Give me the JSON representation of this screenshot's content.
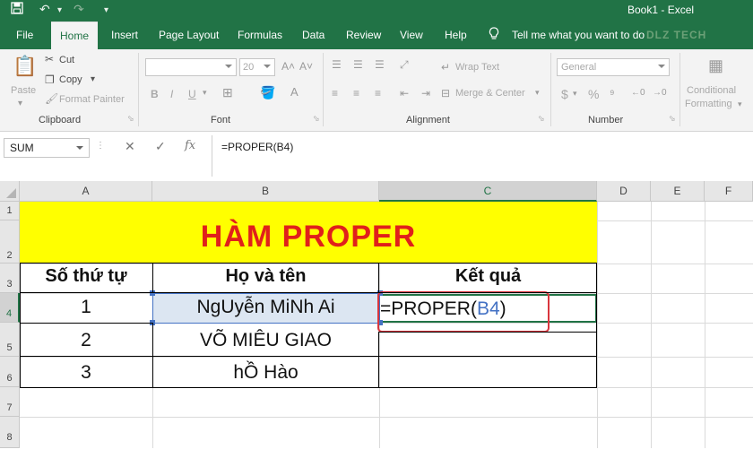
{
  "window": {
    "title": "Book1 - Excel"
  },
  "quick_access": [
    "save-icon",
    "undo-icon",
    "redo-icon",
    "customize-qat-icon"
  ],
  "tabs": [
    "File",
    "Home",
    "Insert",
    "Page Layout",
    "Formulas",
    "Data",
    "Review",
    "View",
    "Help"
  ],
  "active_tab": "Home",
  "tell_me": "Tell me what you want to do",
  "watermark": "DLZ TECH",
  "ribbon": {
    "clipboard": {
      "paste": "Paste",
      "cut": "Cut",
      "copy": "Copy",
      "format_painter": "Format Painter",
      "label": "Clipboard"
    },
    "font": {
      "size": "20",
      "bold": "B",
      "italic": "I",
      "underline": "U",
      "label": "Font"
    },
    "alignment": {
      "wrap_text": "Wrap Text",
      "merge_center": "Merge & Center",
      "label": "Alignment"
    },
    "number": {
      "format": "General",
      "currency": "$",
      "percent": "%",
      "label": "Number"
    },
    "styles": {
      "conditional_formatting_line1": "Conditional",
      "conditional_formatting_line2": "Formatting"
    }
  },
  "formula_bar": {
    "name_box": "SUM",
    "cancel": "✕",
    "enter": "✓",
    "fx": "fx",
    "formula": "=PROPER(B4)"
  },
  "columns": [
    "A",
    "B",
    "C",
    "D",
    "E",
    "F"
  ],
  "rows": [
    "1",
    "2",
    "3",
    "4",
    "5",
    "6",
    "7",
    "8"
  ],
  "sheet": {
    "title": "HÀM PROPER",
    "headers": [
      "Số thứ tự",
      "Họ và tên",
      "Kết quả"
    ],
    "data": [
      {
        "no": "1",
        "name": "NgUyễn MiNh Ai"
      },
      {
        "no": "2",
        "name": "VÕ MIÊU GIAO"
      },
      {
        "no": "3",
        "name": "hỒ Hào"
      }
    ],
    "edit": {
      "prefix": "=PROPER(",
      "ref": "B4",
      "suffix": ")"
    }
  },
  "colors": {
    "excel_green": "#217346",
    "title_fill": "#ffff00",
    "title_text": "#e0201b",
    "selected_fill": "#dce6f2",
    "ref_blue": "#4472c4",
    "edit_highlight": "#d9363e"
  }
}
